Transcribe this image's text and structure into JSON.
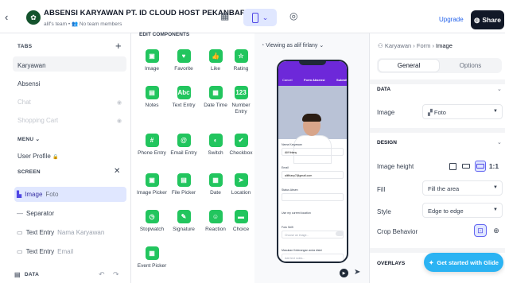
{
  "header": {
    "app_title": "ABSENSI KARYAWAN PT. ID CLOUD HOST PEKANBARU",
    "team": "alif's team",
    "members": "No team members",
    "upgrade": "Upgrade",
    "share": "Share"
  },
  "left": {
    "tabs_title": "TABS",
    "tabs": [
      {
        "label": "Karyawan",
        "hidden": false
      },
      {
        "label": "Absensi",
        "hidden": false
      },
      {
        "label": "Chat",
        "hidden": true
      },
      {
        "label": "Shopping Cart",
        "hidden": true
      }
    ],
    "menu_title": "MENU",
    "menu_items": [
      {
        "label": "User Profile"
      }
    ],
    "screen_title": "SCREEN",
    "screen_items": [
      {
        "label": "Image",
        "sub": "Foto",
        "selected": true
      },
      {
        "label": "Separator",
        "sub": ""
      },
      {
        "label": "Text Entry",
        "sub": "Nama Karyawan"
      },
      {
        "label": "Text Entry",
        "sub": "Email"
      }
    ],
    "data_title": "DATA"
  },
  "components": {
    "title": "EDIT COMPONENTS",
    "items": [
      {
        "label": "Image",
        "glyph": "▣"
      },
      {
        "label": "Favorite",
        "glyph": "♥"
      },
      {
        "label": "Like",
        "glyph": "👍"
      },
      {
        "label": "Rating",
        "glyph": "☆"
      },
      {
        "label": "Notes",
        "glyph": "▤"
      },
      {
        "label": "Text Entry",
        "glyph": "Abc"
      },
      {
        "label": "Date Time",
        "glyph": "▦"
      },
      {
        "label": "Number Entry",
        "glyph": "123"
      },
      {
        "label": "Phone Entry",
        "glyph": "#"
      },
      {
        "label": "Email Entry",
        "glyph": "@"
      },
      {
        "label": "Switch",
        "glyph": "◐"
      },
      {
        "label": "Checkbox",
        "glyph": "✔"
      },
      {
        "label": "Image Picker",
        "glyph": "▣"
      },
      {
        "label": "File Picker",
        "glyph": "▤"
      },
      {
        "label": "Date",
        "glyph": "▦"
      },
      {
        "label": "Location",
        "glyph": "➤"
      },
      {
        "label": "Stopwatch",
        "glyph": "◷"
      },
      {
        "label": "Signature",
        "glyph": "✎"
      },
      {
        "label": "Reaction",
        "glyph": "☺"
      },
      {
        "label": "Choice",
        "glyph": "▬"
      },
      {
        "label": "Event Picker",
        "glyph": "▦"
      }
    ]
  },
  "canvas": {
    "viewing_label": "Viewing as alif firlany",
    "phone": {
      "cancel": "Cancel",
      "title": "Form Absensi",
      "submit": "Submit",
      "fields": [
        {
          "label": "Nama Karyawan",
          "value": "Alif firlany",
          "placeholder": false
        },
        {
          "label": "Email",
          "value": "alifirlany7@gmail.com",
          "placeholder": false
        },
        {
          "label": "Status Absen",
          "value": "",
          "placeholder": false
        },
        {
          "label": "Use my current location",
          "value": "",
          "placeholder": false
        },
        {
          "label": "Foto Selfi",
          "value": "Choose an image...",
          "placeholder": true
        },
        {
          "label": "Masukan Keterangan anda disini",
          "value": "Add text notes...",
          "placeholder": true
        }
      ]
    }
  },
  "right": {
    "crumbs": [
      "Karyawan",
      "Form",
      "Image"
    ],
    "tab_general": "General",
    "tab_options": "Options",
    "data_title": "DATA",
    "image_label": "Image",
    "image_value": "Foto",
    "design_title": "DESIGN",
    "image_height_label": "Image height",
    "ratio_label": "1:1",
    "fill_label": "Fill",
    "fill_value": "Fill the area",
    "style_label": "Style",
    "style_value": "Edge to edge",
    "crop_label": "Crop Behavior",
    "overlays_title": "OVERLAYS",
    "cta": "Get started with Glide"
  },
  "colors": {
    "accent": "#4f46e5",
    "component_green": "#22c55e",
    "phone_header": "#6d28d9",
    "cta": "#2bb3f3"
  }
}
